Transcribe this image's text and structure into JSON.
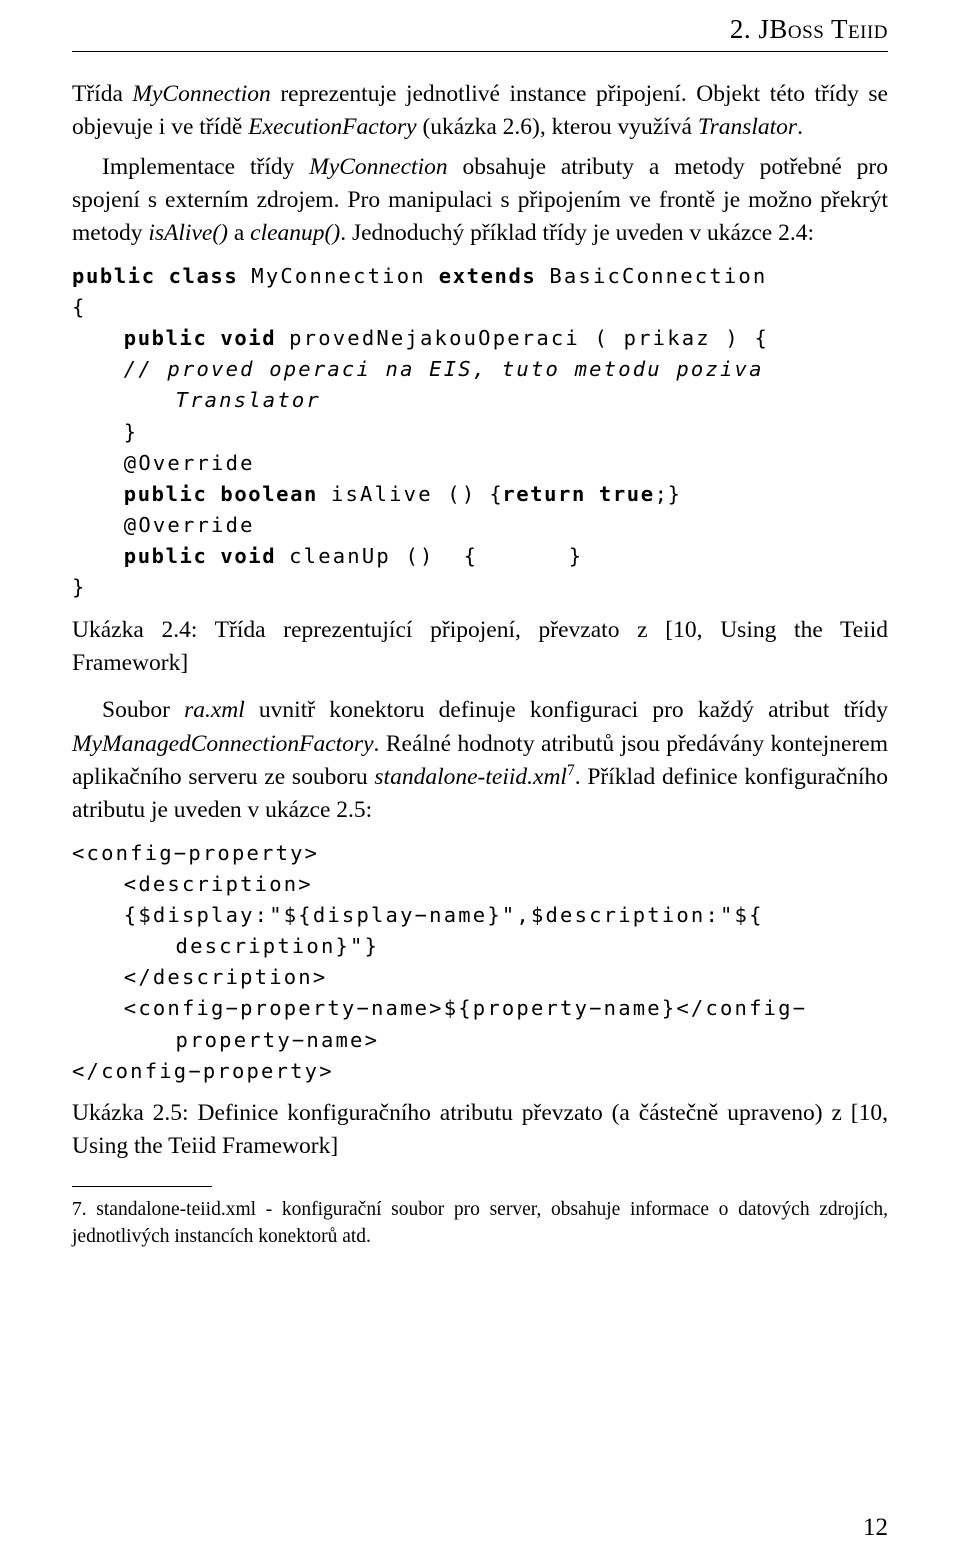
{
  "header": {
    "chapter_number": "2.",
    "chapter_title": "JBoss Teiid"
  },
  "paragraphs": {
    "p1_a": "Třída ",
    "p1_b": "MyConnection",
    "p1_c": " reprezentuje jednotlivé instance připojení. Objekt této třídy se objevuje i ve třídě ",
    "p1_d": "ExecutionFactory",
    "p1_e": " (ukázka 2.6), kterou využívá ",
    "p1_f": "Translator",
    "p1_g": ".",
    "p2_a": "Implementace třídy ",
    "p2_b": "MyConnection",
    "p2_c": " obsahuje atributy a metody potřebné pro spojení s externím zdrojem. Pro manipulaci s připojením ve frontě je možno překrýt metody ",
    "p2_d": "isAlive()",
    "p2_e": " a ",
    "p2_f": "cleanup()",
    "p2_g": ". Jednoduchý příklad třídy je uveden v ukázce 2.4:",
    "p3_a": "Soubor ",
    "p3_b": "ra.xml",
    "p3_c": " uvnitř konektoru definuje konfiguraci pro každý atribut třídy ",
    "p3_d": "MyManagedConnectionFactory",
    "p3_e": ". Reálné hodnoty atributů jsou předávány kontejnerem aplikačního serveru ze souboru ",
    "p3_f": "standalone-teiid.xml",
    "p3_g": "7",
    "p3_h": ". Příklad definice konfiguračního atributu je uveden v ukázce 2.5:"
  },
  "listing_1": {
    "line_1_kw1": "public",
    "line_1_kw2": "class",
    "line_1_name": "MyConnection",
    "line_1_kw3": "extends",
    "line_1_super": "BasicConnection",
    "line_2": "{",
    "line_3_kw1": "public",
    "line_3_kw2": "void",
    "line_3_sig": "provedNejakouOperaci ( prikaz ) {",
    "line_4_comment": "// proved operaci na EIS, tuto metodu poziva",
    "line_5_comment": "Translator",
    "line_6": "}",
    "line_7": "@Override",
    "line_8_kw1": "public",
    "line_8_kw2": "boolean",
    "line_8_sig": "isAlive ()",
    "line_8_body_open": "{",
    "line_8_kw3": "return",
    "line_8_kw4": "true",
    "line_8_body_close": ";}",
    "line_9": "@Override",
    "line_10_kw1": "public",
    "line_10_kw2": "void",
    "line_10_sig": "cleanUp ()  {",
    "line_10_end": "}",
    "line_11": "}"
  },
  "caption_1": "Ukázka 2.4: Třída reprezentující připojení, převzato z [10, Using the Teiid Framework]",
  "listing_2": {
    "line_1": "<config−property>",
    "line_2": "<description>",
    "line_3": "{$display:\"${display−name}\",$description:\"${",
    "line_4": "description}\"}",
    "line_5": "</description>",
    "line_6": "<config−property−name>${property−name}</config−",
    "line_7": "property−name>",
    "line_8": "</config−property>"
  },
  "caption_2": "Ukázka 2.5: Definice konfiguračního atributu převzato (a částečně upraveno) z [10, Using the Teiid Framework]",
  "footnote": {
    "marker": "7.",
    "text": "standalone-teiid.xml - konfigurační soubor pro server, obsahuje informace o datových zdrojích, jednotlivých instancích konektorů atd."
  },
  "page_number": "12"
}
